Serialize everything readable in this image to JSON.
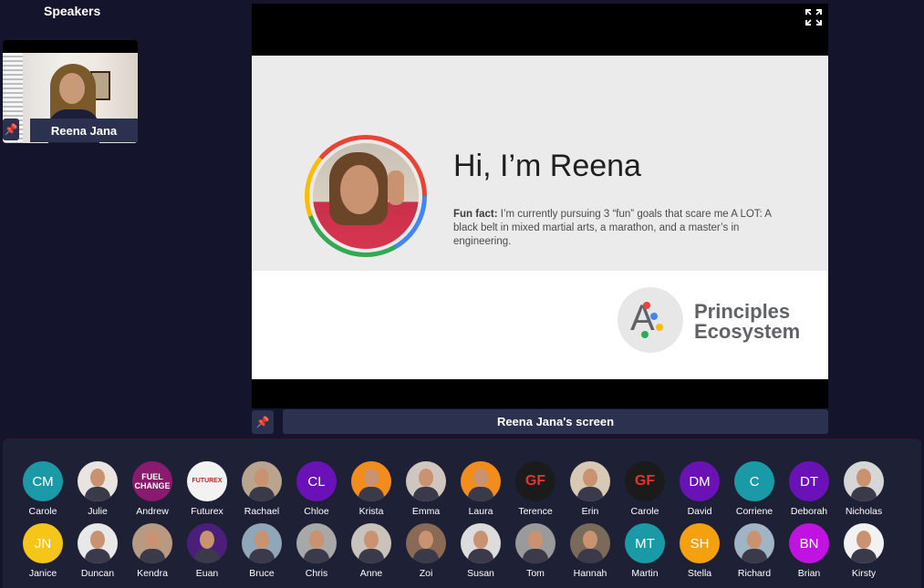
{
  "speakers": {
    "title": "Speakers",
    "tiles": [
      {
        "name": "Reena Jana"
      }
    ]
  },
  "screen_share": {
    "label": "Reena Jana's screen",
    "slide": {
      "title": "Hi, I’m Reena",
      "fun_fact_label": "Fun fact:",
      "fun_fact_text": " I’m currently pursuing 3 “fun” goals that scare me A LOT: A black belt in mixed martial arts, a marathon, and a master’s in engineering.",
      "logo_letter": "A",
      "logo_line1": "Principles",
      "logo_line2": "Ecosystem"
    }
  },
  "attendees": {
    "row1": [
      {
        "name": "Carole",
        "initials": "CM",
        "color": "#1a9aa6",
        "kind": "initials"
      },
      {
        "name": "Julie",
        "initials": "",
        "color": "#e9e4df",
        "kind": "photo"
      },
      {
        "name": "Andrew",
        "initials": "FUEL CHANGE",
        "color": "#8a1a6e",
        "kind": "logo"
      },
      {
        "name": "Futurex",
        "initials": "FUTUREX",
        "color": "#f2f2f2",
        "kind": "logo"
      },
      {
        "name": "Rachael",
        "initials": "",
        "color": "#b9a48e",
        "kind": "photo"
      },
      {
        "name": "Chloe",
        "initials": "CL",
        "color": "#6a12b8",
        "kind": "initials"
      },
      {
        "name": "Krista",
        "initials": "",
        "color": "#f28c1b",
        "kind": "photo"
      },
      {
        "name": "Emma",
        "initials": "",
        "color": "#cfc6bf",
        "kind": "photo"
      },
      {
        "name": "Laura",
        "initials": "",
        "color": "#f28c1b",
        "kind": "photo"
      },
      {
        "name": "Terence",
        "initials": "GF",
        "color": "#1b1b1b",
        "kind": "logo"
      },
      {
        "name": "Erin",
        "initials": "",
        "color": "#d8c9b4",
        "kind": "photo"
      },
      {
        "name": "Carole",
        "initials": "GF",
        "color": "#1b1b1b",
        "kind": "logo"
      },
      {
        "name": "David",
        "initials": "DM",
        "color": "#6a12b8",
        "kind": "initials"
      },
      {
        "name": "Corriene",
        "initials": "C",
        "color": "#1a9aa6",
        "kind": "initials"
      },
      {
        "name": "Deborah",
        "initials": "DT",
        "color": "#6a12b8",
        "kind": "initials"
      },
      {
        "name": "Nicholas",
        "initials": "",
        "color": "#d6d6d6",
        "kind": "photo"
      }
    ],
    "row2": [
      {
        "name": "Janice",
        "initials": "JN",
        "color": "#f5c518",
        "kind": "initials"
      },
      {
        "name": "Duncan",
        "initials": "",
        "color": "#e8e8e8",
        "kind": "photo"
      },
      {
        "name": "Kendra",
        "initials": "",
        "color": "#b89a82",
        "kind": "photo"
      },
      {
        "name": "Euan",
        "initials": "",
        "color": "#4a1f7a",
        "kind": "photo"
      },
      {
        "name": "Bruce",
        "initials": "",
        "color": "#8fa7b8",
        "kind": "photo"
      },
      {
        "name": "Chris",
        "initials": "",
        "color": "#a8a8a8",
        "kind": "photo"
      },
      {
        "name": "Anne",
        "initials": "",
        "color": "#c9c3bb",
        "kind": "photo"
      },
      {
        "name": "Zoi",
        "initials": "",
        "color": "#8a6a54",
        "kind": "photo"
      },
      {
        "name": "Susan",
        "initials": "",
        "color": "#dcdcdc",
        "kind": "photo"
      },
      {
        "name": "Tom",
        "initials": "",
        "color": "#9a9a9a",
        "kind": "photo"
      },
      {
        "name": "Hannah",
        "initials": "",
        "color": "#7a6a5a",
        "kind": "photo"
      },
      {
        "name": "Martin",
        "initials": "MT",
        "color": "#1a9aa6",
        "kind": "initials"
      },
      {
        "name": "Stella",
        "initials": "SH",
        "color": "#f5a10f",
        "kind": "initials"
      },
      {
        "name": "Richard",
        "initials": "",
        "color": "#9fb4c4",
        "kind": "photo"
      },
      {
        "name": "Brian",
        "initials": "BN",
        "color": "#c012e0",
        "kind": "initials"
      },
      {
        "name": "Kirsty",
        "initials": "",
        "color": "#f2f2f2",
        "kind": "photo"
      }
    ]
  }
}
